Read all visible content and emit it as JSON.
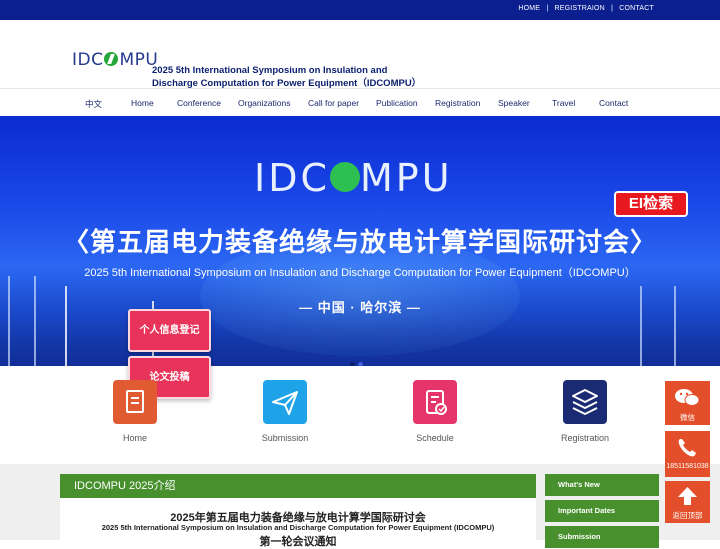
{
  "top_links": [
    "HOME",
    "REGISTRAION",
    "CONTACT"
  ],
  "top_separator": "|",
  "logo_text": {
    "pre": "IDC",
    "post": "MPU"
  },
  "header_title": {
    "line1": "2025 5th International Symposium on Insulation and",
    "line2": "Discharge Computation for Power Equipment（IDCOMPU）"
  },
  "nav": [
    "中文",
    "Home",
    "Conference",
    "Organizations",
    "Call for paper",
    "Publication",
    "Registration",
    "Speaker",
    "Travel",
    "Contact"
  ],
  "banner": {
    "logo": {
      "pre": "IDC",
      "post": "MPU"
    },
    "ei_badge": "EI检索",
    "title_cn": "〈第五届电力装备绝缘与放电计算学国际研讨会〉",
    "title_en": "2025 5th International Symposium on Insulation and Discharge Computation for Power Equipment（IDCOMPU）",
    "place": "— 中国 · 哈尔滨 —"
  },
  "overlay_buttons": [
    "个人信息登记",
    "论文投稿"
  ],
  "quick_links": [
    {
      "label": "Home",
      "icon": "document-icon",
      "color": "#e05a32"
    },
    {
      "label": "Submission",
      "icon": "paper-plane-icon",
      "color": "#1fa3e8"
    },
    {
      "label": "Schedule",
      "icon": "clipboard-check-icon",
      "color": "#e6356a"
    },
    {
      "label": "Registration",
      "icon": "layers-icon",
      "color": "#1b2b73"
    }
  ],
  "panel": {
    "heading": "IDCOMPU 2025介绍",
    "line1": "2025年第五届电力装备绝缘与放电计算学国际研讨会",
    "line2": "2025 5th International Symposium on Insulation and Discharge Computation for Power Equipment (IDCOMPU)",
    "line3": "第一轮会议通知"
  },
  "side_menu": [
    "What's New",
    "Important Dates",
    "Submission"
  ],
  "floating": [
    {
      "label": "微信",
      "icon": "wechat-icon"
    },
    {
      "label": "18511581038",
      "icon": "phone-icon"
    },
    {
      "label": "返回顶部",
      "icon": "arrow-up-icon"
    }
  ],
  "colors": {
    "topbar": "#0c1f8f",
    "accent_green": "#48902e",
    "float_orange": "#e34f2a",
    "pill_pink": "#e8345a",
    "ei_red": "#e8191e"
  }
}
